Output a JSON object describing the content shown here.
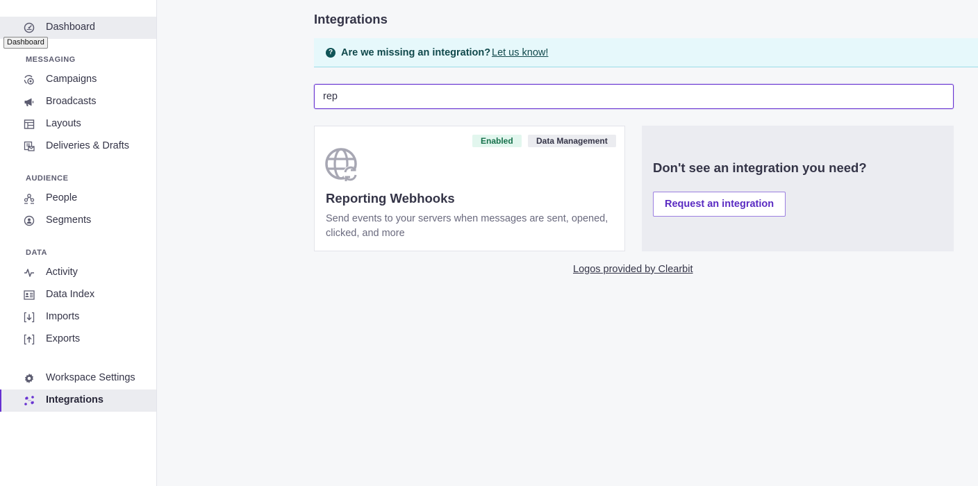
{
  "sidebar": {
    "tooltip": "Dashboard",
    "top_items": [
      {
        "label": "Dashboard",
        "icon": "dashboard-icon"
      }
    ],
    "sections": {
      "messaging": {
        "header": "Messaging",
        "items": [
          {
            "label": "Campaigns",
            "icon": "campaigns-icon"
          },
          {
            "label": "Broadcasts",
            "icon": "megaphone-icon"
          },
          {
            "label": "Layouts",
            "icon": "layout-icon"
          },
          {
            "label": "Deliveries & Drafts",
            "icon": "deliveries-icon"
          }
        ]
      },
      "audience": {
        "header": "Audience",
        "items": [
          {
            "label": "People",
            "icon": "people-icon"
          },
          {
            "label": "Segments",
            "icon": "segments-icon"
          }
        ]
      },
      "data": {
        "header": "Data",
        "items": [
          {
            "label": "Activity",
            "icon": "activity-icon"
          },
          {
            "label": "Data Index",
            "icon": "data-index-icon"
          },
          {
            "label": "Imports",
            "icon": "import-icon"
          },
          {
            "label": "Exports",
            "icon": "export-icon"
          }
        ]
      }
    },
    "bottom_items": [
      {
        "label": "Workspace Settings",
        "icon": "gear-icon"
      },
      {
        "label": "Integrations",
        "icon": "puzzle-icon",
        "active": true
      }
    ]
  },
  "main": {
    "title": "Integrations",
    "banner": {
      "question": "Are we missing an integration?",
      "link": "Let us know!"
    },
    "search": {
      "value": "rep",
      "placeholder": ""
    },
    "results": [
      {
        "status_badge": "Enabled",
        "category_badge": "Data Management",
        "title": "Reporting Webhooks",
        "description": "Send events to your servers when messages are sent, opened, clicked, and more",
        "icon": "globe-refresh-icon"
      }
    ],
    "request_panel": {
      "title": "Don't see an integration you need?",
      "button": "Request an integration"
    },
    "footer_link": "Logos provided by Clearbit"
  },
  "colors": {
    "accent": "#6732d1",
    "banner_bg": "#e6f8fb",
    "enabled_bg": "#e2f6ee",
    "enabled_text": "#15704a"
  }
}
